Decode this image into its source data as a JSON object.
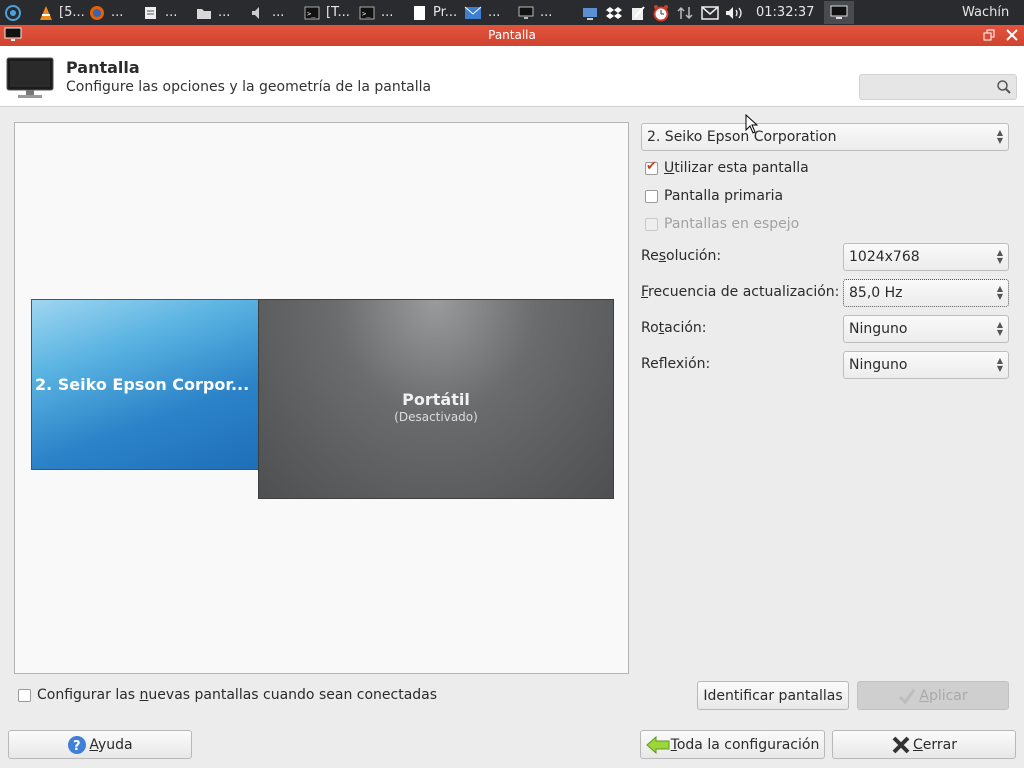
{
  "panel": {
    "tasks": [
      {
        "label": "[5...",
        "icon": "vlc-icon"
      },
      {
        "label": "...",
        "icon": "firefox-icon"
      },
      {
        "label": "...",
        "icon": "text-editor-icon"
      },
      {
        "label": "...",
        "icon": "folder-icon"
      },
      {
        "label": "...",
        "icon": "speaker-icon"
      },
      {
        "label": "[T...",
        "icon": "terminal-icon"
      },
      {
        "label": "...",
        "icon": "terminal-icon"
      },
      {
        "label": "Pr...",
        "icon": "document-icon"
      },
      {
        "label": "...",
        "icon": "mail-icon"
      },
      {
        "label": "...",
        "icon": "display-icon"
      }
    ],
    "clock": "01:32:37",
    "user": "Wachín"
  },
  "window": {
    "title": "Pantalla"
  },
  "header": {
    "title": "Pantalla",
    "subtitle": "Configure las opciones y la geometría de la pantalla",
    "search_placeholder": ""
  },
  "displays": {
    "active_label": "2. Seiko Epson Corpor...",
    "laptop_name": "Portátil",
    "laptop_state": "(Desactivado)"
  },
  "settings": {
    "selected_display": "2. Seiko Epson Corporation",
    "use_display": {
      "pre": "",
      "ul": "U",
      "post": "tilizar esta pantalla",
      "checked": true
    },
    "primary_display": {
      "label": "Pantalla primaria",
      "checked": false
    },
    "mirror_displays": {
      "label": "Pantallas en espejo",
      "checked": false,
      "disabled": true
    },
    "resolution": {
      "pre": "Re",
      "ul": "s",
      "post": "olución:",
      "value": "1024x768"
    },
    "refresh_rate": {
      "pre": "",
      "ul": "F",
      "post": "recuencia de actualización:",
      "value": "85,0 Hz"
    },
    "rotation": {
      "pre": "Ro",
      "ul": "t",
      "post": "ación:",
      "value": "Ninguno"
    },
    "reflection": {
      "pre": "Ref",
      "ul": "l",
      "post": "exión:",
      "value": "Ninguno"
    }
  },
  "bottom": {
    "configure_new": {
      "pre": "Configurar las ",
      "ul": "n",
      "post": "uevas pantallas cuando sean conectadas",
      "checked": false
    },
    "identify_label": "Identificar pantallas",
    "apply": {
      "pre": "",
      "ul": "A",
      "post": "plicar"
    }
  },
  "footer": {
    "help": {
      "pre": "",
      "ul": "A",
      "post": "yuda"
    },
    "all_settings": {
      "pre": "",
      "ul": "T",
      "post": "oda la configuración"
    },
    "close": {
      "pre": "",
      "ul": "C",
      "post": "errar"
    }
  },
  "colors": {
    "titlebar": "#d9472f",
    "panel": "#2a2b2e",
    "active_display": "#2c83c8",
    "inactive_display": "#5a5b5d"
  }
}
